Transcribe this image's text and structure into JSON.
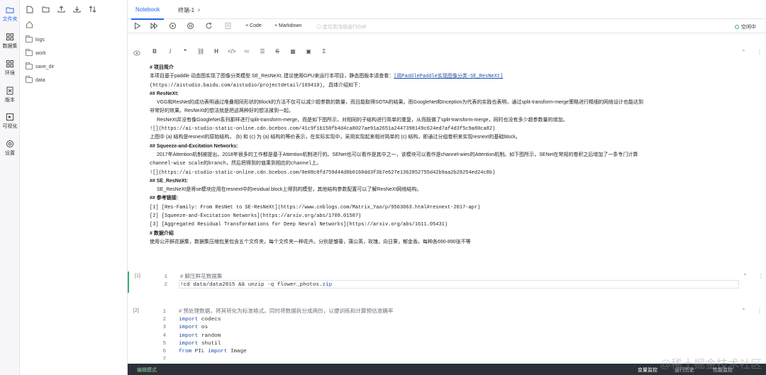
{
  "rail": {
    "items": [
      {
        "label": "文件夹",
        "icon": "folder-icon"
      },
      {
        "label": "数据集",
        "icon": "dataset-icon"
      },
      {
        "label": "环境",
        "icon": "env-icon"
      },
      {
        "label": "版本",
        "icon": "version-icon"
      },
      {
        "label": "可视化",
        "icon": "visual-icon"
      },
      {
        "label": "设置",
        "icon": "settings-icon"
      }
    ]
  },
  "files": {
    "toolbar": [
      "new-file-icon",
      "new-folder-icon",
      "upload-icon",
      "download-icon",
      "refresh-icon"
    ],
    "items": [
      "logs",
      "work",
      "save_dir",
      "data"
    ],
    "collapse_label": "«"
  },
  "tabs": [
    {
      "label": "Notebook"
    },
    {
      "label": "终端-1",
      "close": "×"
    }
  ],
  "runbar": {
    "code_label": "+ Code",
    "markdown_label": "+ Markdown",
    "locate_label": "定位到当前运行Cell",
    "status_label": "空闲中"
  },
  "markdown": {
    "lines": [
      "# 项目简介",
      "本项目基于paddle 动态图实现了图像分类模型 SE_ResNeXt, 建议使用GPU来运行本项目，静态图版本请查看：",
      "[用PaddlePaddle实现图像分类-SE_ResNeXt]",
      "(https://aistudio.baidu.com/aistudio/projectdetail/169410), 具体介绍如下：",
      "## ResNeXt:",
      "VGG和ResNet的成功表明通过堆叠相同形状的Block的方法不仅可以减少超参数的数量，而且能取得SOTA的结果。而GoogleNet和Inception为代表的实践也表明，通过split-transform-merge策略进行精细的网络设计也能达到",
      "非常好的效果。ResNeXt的想法就是把这两种好的想法揉到一起。",
      "ResNeXt并没有像GoogleNet系列那样进行split-transform-merge，而是如下图所示，对相同的子结构进行简单的重复，从而既做了split-transform-merge，同时也没有多少超参数量的增加。",
      "![](https://ai-studio-static-online.cdn.bcebos.com/41c9f1b158fb4d4ca8027ae91a2651a2447398149c624ed7af4d3f5c9a80ca82)",
      "上图中 (a) 结构是resnext的原始结构， (b) 和 (c) 为 (a) 结构的等价表示，在实际实现中，采用实现起来相对简单的 (c) 结构，即通过分组卷积来实现resnext的基础block。",
      "## Squeeze-and-Excitation Networks:",
      "2017年Attention机制被提出，2018年很多的工作都是基于Attention机制进行的。SENet也可以看作是其中之一，该模块可以看作是channel-wies的Attention机制。如下图所示，SENet在常规的卷积之后增加了一条专门计算",
      "channel-wise scale的branch，然后把得到的值乘到相应的channel上。",
      "![](https://ai-studio-static-online.cdn.bcebos.com/0e08c0fd759d44d8b0160dd3f3b7e627e1362852755d42b9aa2b28254ed24c8b)",
      "## SE_ResNeXt:",
      "SE_ResNeXt是将se模块应用在resnext中的residual block上得到的模型，其他结构参数配置可以了解ResNeXt网络结构。",
      "## 参考链接:",
      "[1] [Res-Family: From ResNet to SE-ResNeXt](https://www.cnblogs.com/Matrix_Yao/p/9563063.html#resnext-2017-apr)",
      "[2] [Squeeze-and-Excitation Networks](https://arxiv.org/abs/1709.01507)",
      "[3] [Aggregated Residual Transformations for Deep Neural Networks](https://arxiv.org/abs/1611.05431)",
      "# 数据介绍",
      "使用公开鲜花据集，数据集压缩包里包含五个文件夹，每个文件夹一种花卉。分别是雏菊，蒲公英，玫瑰，向日葵，郁金香。每种各690-890张不等"
    ]
  },
  "cell1": {
    "prompt": "[1]",
    "lines": [
      {
        "n": "1",
        "comment": "# 解压鲜花数据集"
      },
      {
        "n": "2",
        "code": "!cd data/data2815 && unzip -q flower_photos.",
        "ext": "zip"
      }
    ]
  },
  "cell2": {
    "prompt": "[2]",
    "lines": [
      {
        "n": "1",
        "comment": "# 预处理数据，将其转化为标准格式。同时将数据拆分成两份，以便训练和计算预估准确率"
      },
      {
        "n": "2",
        "kw": "import",
        "rest": "codecs"
      },
      {
        "n": "3",
        "kw": "import",
        "rest": "os"
      },
      {
        "n": "4",
        "kw": "import",
        "rest": "random"
      },
      {
        "n": "5",
        "kw": "import",
        "rest": "shutil"
      },
      {
        "n": "6",
        "kw": "from",
        "mid": "PIL",
        "kw2": "import",
        "rest": "Image"
      },
      {
        "n": "7"
      }
    ]
  },
  "bottombar": {
    "mode": "编辑模式",
    "items": [
      "变量监控",
      "运行历史",
      "性能监控"
    ]
  },
  "watermark": "@稀土掘金技术社区"
}
